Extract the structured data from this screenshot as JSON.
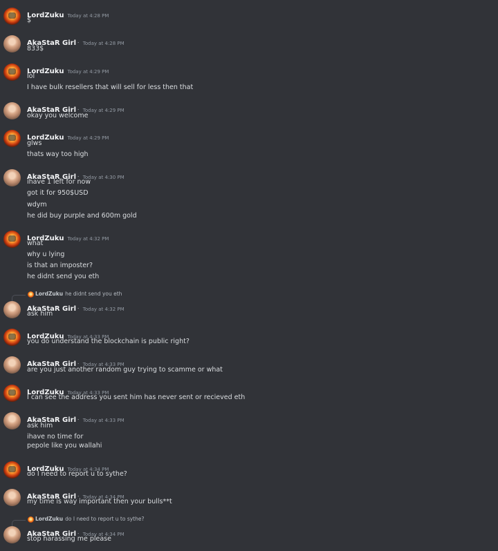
{
  "users": {
    "zuku": {
      "name": "LordZuku"
    },
    "girl": {
      "name": "AkaStaR Girl",
      "badge": "ˑ"
    }
  },
  "messages": [
    {
      "author": "zuku",
      "time": "Today at 4:28 PM",
      "lines": [
        "$"
      ]
    },
    {
      "author": "girl",
      "time": "Today at 4:28 PM",
      "lines": [
        "833$"
      ]
    },
    {
      "author": "zuku",
      "time": "Today at 4:29 PM",
      "lines": [
        "lol",
        "I have bulk resellers that will sell for less then that"
      ]
    },
    {
      "author": "girl",
      "time": "Today at 4:29 PM",
      "lines": [
        "okay you  welcome"
      ]
    },
    {
      "author": "zuku",
      "time": "Today at 4:29 PM",
      "lines": [
        "glws",
        "thats way too high"
      ]
    },
    {
      "author": "girl",
      "time": "Today at 4:30 PM",
      "lines": [
        "ihave 1 left for now",
        "got it for 950$USD",
        "wdym",
        "he did buy purple and 600m gold"
      ]
    },
    {
      "author": "zuku",
      "time": "Today at 4:32 PM",
      "lines": [
        "what",
        "why u lying",
        "is that an imposter?",
        "he didnt send you eth"
      ]
    },
    {
      "author": "girl",
      "time": "Today at 4:32 PM",
      "lines": [
        "ask him"
      ],
      "reply": {
        "author": "LordZuku",
        "text": "he didnt send you eth"
      }
    },
    {
      "author": "zuku",
      "time": "Today at 4:33 PM",
      "lines": [
        "you do understand the blockchain is public right?"
      ]
    },
    {
      "author": "girl",
      "time": "Today at 4:33 PM",
      "lines": [
        "are you just another random guy trying to scamme or what"
      ]
    },
    {
      "author": "zuku",
      "time": "Today at 4:33 PM",
      "lines": [
        "I can see the address you sent him has never sent or recieved eth"
      ]
    },
    {
      "author": "girl",
      "time": "Today at 4:33 PM",
      "lines": [
        "ask him",
        "ihave no time for",
        "pepole like you wallahi"
      ]
    },
    {
      "author": "zuku",
      "time": "Today at 4:34 PM",
      "lines": [
        "do I need to report u to sythe?"
      ]
    },
    {
      "author": "girl",
      "time": "Today at 4:34 PM",
      "lines": [
        "my time is way important then your bulls**t"
      ]
    },
    {
      "author": "girl",
      "time": "Today at 4:34 PM",
      "lines": [
        "stop harassing me please"
      ],
      "reply": {
        "author": "LordZuku",
        "text": "do I need to report u to sythe?"
      }
    }
  ]
}
